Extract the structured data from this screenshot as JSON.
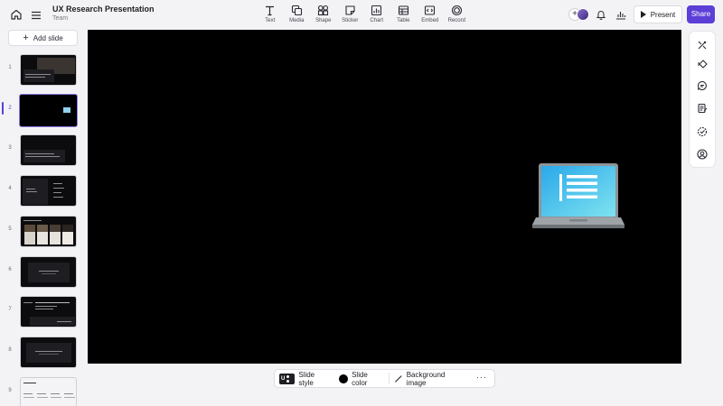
{
  "app": {
    "title": "UX Research Presentation",
    "subtitle": "Team"
  },
  "toolbar": {
    "tools": [
      {
        "label": "Text",
        "icon": "text-icon"
      },
      {
        "label": "Media",
        "icon": "media-icon"
      },
      {
        "label": "Shape",
        "icon": "shape-icon"
      },
      {
        "label": "Sticker",
        "icon": "sticker-icon"
      },
      {
        "label": "Chart",
        "icon": "chart-icon"
      },
      {
        "label": "Table",
        "icon": "table-icon"
      },
      {
        "label": "Embed",
        "icon": "embed-icon"
      },
      {
        "label": "Record",
        "icon": "record-icon"
      }
    ],
    "avatar_plus": "+",
    "present_label": "Present",
    "share_label": "Share"
  },
  "sidebar": {
    "add_slide_label": "Add slide",
    "slides": [
      {
        "number": "1",
        "active": false
      },
      {
        "number": "2",
        "active": true
      },
      {
        "number": "3",
        "active": false
      },
      {
        "number": "4",
        "active": false
      },
      {
        "number": "5",
        "active": false
      },
      {
        "number": "6",
        "active": false
      },
      {
        "number": "7",
        "active": false
      },
      {
        "number": "8",
        "active": false
      },
      {
        "number": "9",
        "active": false
      }
    ]
  },
  "canvas": {
    "background_color": "#000000",
    "graphic": "laptop-icon"
  },
  "bottom_bar": {
    "slide_style_chip": "U",
    "slide_style_label": "Slide style",
    "slide_color_label": "Slide color",
    "background_image_label": "Background image",
    "more_label": "···"
  },
  "right_rail": {
    "icons": [
      "design-tools-icon",
      "animation-icon",
      "comments-icon",
      "notes-icon",
      "checklist-icon",
      "user-icon"
    ]
  },
  "colors": {
    "accent": "#5b3fd6",
    "laptop_screen": "#3fb6e8"
  }
}
